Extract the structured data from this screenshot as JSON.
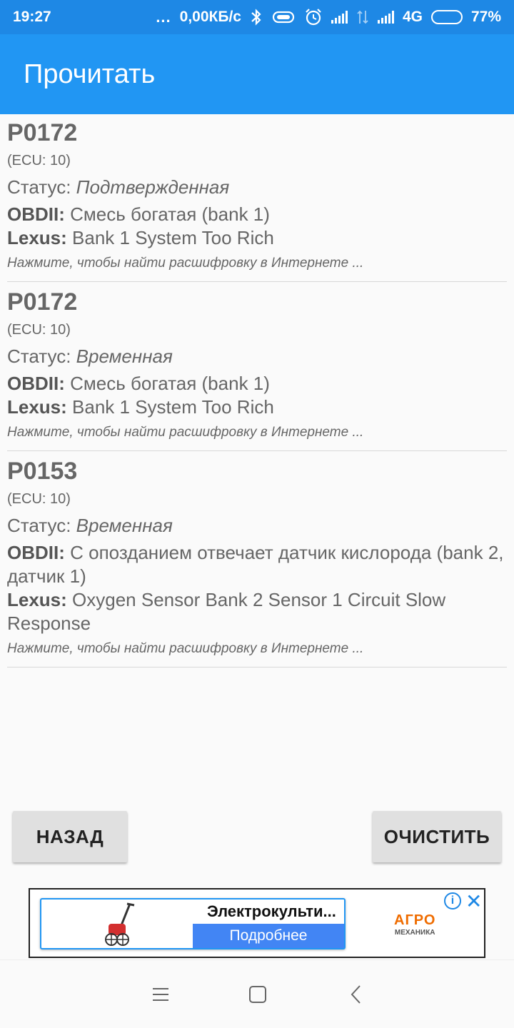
{
  "status_bar": {
    "time": "19:27",
    "more": "...",
    "speed": "0,00КБ/с",
    "network": "4G",
    "battery": "77%",
    "battery_level": 0.77
  },
  "app_bar": {
    "title": "Прочитать"
  },
  "codes": [
    {
      "code": "P0172",
      "ecu": "(ECU: 10)",
      "status_label": "Статус: ",
      "status_value": "Подтвержденная",
      "obd_label": "OBDII:",
      "obd_text": " Смесь богатая (bank 1)",
      "make_label": "Lexus:",
      "make_text": " Bank 1 System Too Rich",
      "hint": "Нажмите, чтобы найти расшифровку в Интернете ..."
    },
    {
      "code": "P0172",
      "ecu": "(ECU: 10)",
      "status_label": "Статус: ",
      "status_value": "Временная",
      "obd_label": "OBDII:",
      "obd_text": " Смесь богатая (bank 1)",
      "make_label": "Lexus:",
      "make_text": " Bank 1 System Too Rich",
      "hint": "Нажмите, чтобы найти расшифровку в Интернете ..."
    },
    {
      "code": "P0153",
      "ecu": "(ECU: 10)",
      "status_label": "Статус: ",
      "status_value": "Временная",
      "obd_label": "OBDII:",
      "obd_text": " С опозданием отвечает датчик кислорода (bank 2, датчик 1)",
      "make_label": "Lexus:",
      "make_text": " Oxygen Sensor Bank 2 Sensor 1 Circuit Slow Response",
      "hint": "Нажмите, чтобы найти расшифровку в Интернете ..."
    }
  ],
  "buttons": {
    "back": "НАЗАД",
    "clear": "ОЧИСТИТЬ"
  },
  "ad": {
    "title": "Электрокульти...",
    "cta": "Подробнее",
    "logo_top": "АГРО",
    "logo_bottom": "МЕХАНИКА",
    "info": "i",
    "close": "✕"
  },
  "colors": {
    "status_bar": "#1e88e5",
    "app_bar": "#2196f3",
    "ad_cta": "#4285f4"
  }
}
